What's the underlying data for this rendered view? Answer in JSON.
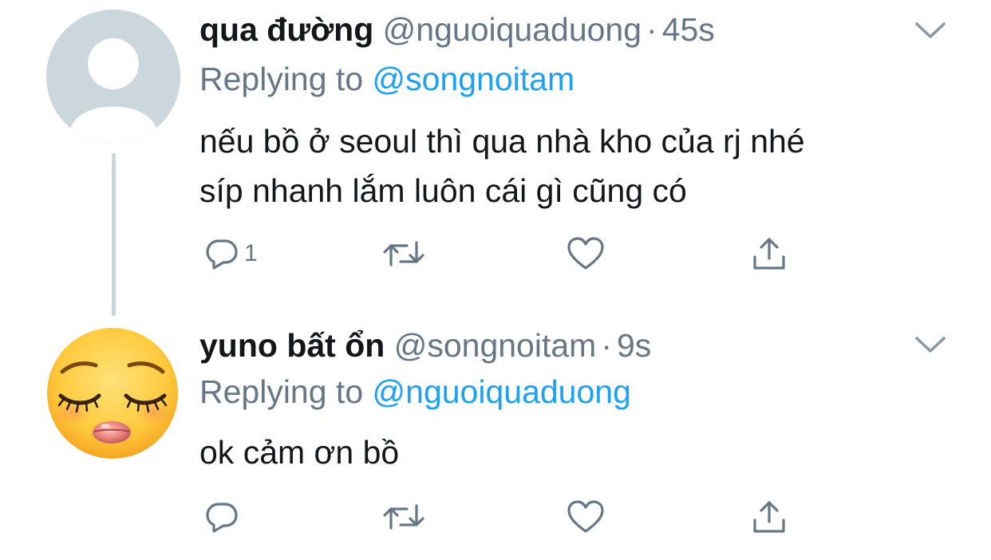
{
  "tweets": [
    {
      "display_name": "qua đường",
      "handle": "@nguoiquaduong",
      "separator": "·",
      "time": "45s",
      "replying_label": "Replying to",
      "replying_to": "@songnoitam",
      "text_line_1": "nếu bồ ở seoul thì qua nhà kho của rj nhé",
      "text_line_2": "síp nhanh lắm luôn cái gì cũng có",
      "reply_count": "1",
      "avatar": "default-avatar-icon"
    },
    {
      "display_name": "yuno bất ổn",
      "handle": "@songnoitam",
      "separator": "·",
      "time": "9s",
      "replying_label": "Replying to",
      "replying_to": "@nguoiquaduong",
      "text_line_1": "ok cảm ơn bồ",
      "reply_count": "",
      "avatar": "emoji-avatar-icon"
    }
  ],
  "colors": {
    "text": "#14171A",
    "secondary": "#657786",
    "accent": "#1DA1F2",
    "thread_line": "#CCD6DD",
    "icon": "#657786"
  }
}
